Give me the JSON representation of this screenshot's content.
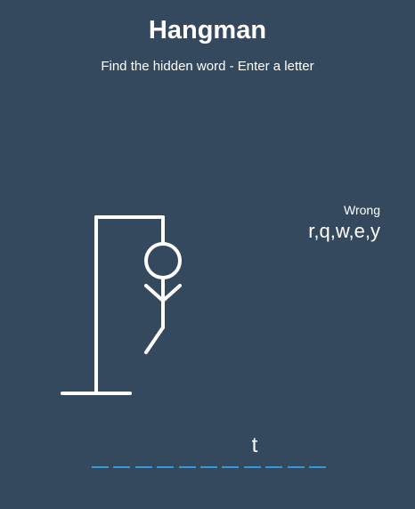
{
  "header": {
    "title": "Hangman",
    "subtitle": "Find the hidden word - Enter a letter"
  },
  "wrong": {
    "label": "Wrong",
    "letters": "r,q,w,e,y"
  },
  "word": {
    "letters": [
      "",
      "",
      "",
      "",
      "",
      "",
      "",
      "t",
      "",
      "",
      ""
    ]
  },
  "figure": {
    "wrong_guess_count": 5,
    "parts_shown": [
      "gallows",
      "head",
      "body",
      "left-arm",
      "right-arm",
      "left-leg"
    ]
  },
  "colors": {
    "background": "#34495e",
    "text": "#ffffff",
    "letter_underline": "#3498db",
    "figure_stroke": "#ffffff"
  }
}
